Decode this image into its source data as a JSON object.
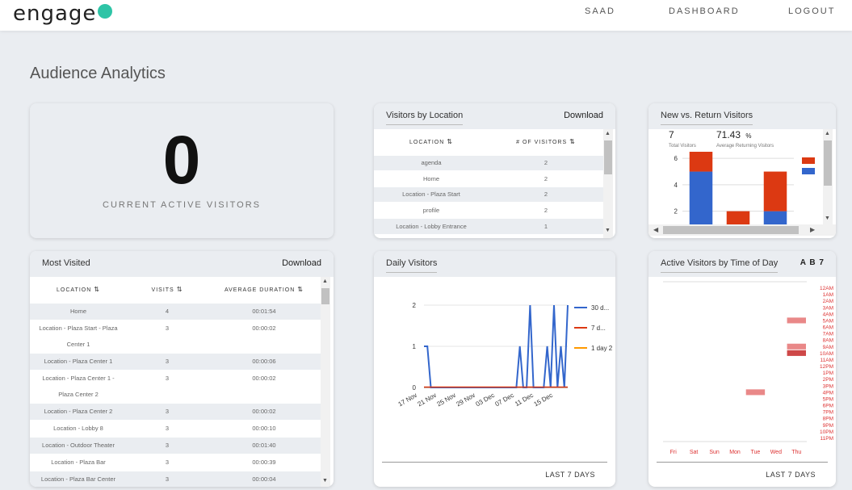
{
  "brand": "engage",
  "nav": {
    "user": "SAAD",
    "dashboard": "DASHBOARD",
    "logout": "LOGOUT"
  },
  "page_title": "Audience Analytics",
  "active": {
    "value": "0",
    "label": "CURRENT ACTIVE VISITORS"
  },
  "by_location": {
    "title": "Visitors by Location",
    "download": "Download",
    "headers": [
      "LOCATION",
      "# OF VISITORS"
    ],
    "rows": [
      [
        "agenda",
        "2"
      ],
      [
        "Home",
        "2"
      ],
      [
        "Location - Plaza Start",
        "2"
      ],
      [
        "profile",
        "2"
      ],
      [
        "Location - Lobby Entrance",
        "1"
      ]
    ]
  },
  "new_return": {
    "title": "New vs. Return Visitors",
    "total_value": "7",
    "total_label": "Total Visitors",
    "avg_value": "71.43",
    "avg_unit": "%",
    "avg_label": "Average Returning Visitors",
    "chart_data": {
      "type": "bar",
      "stacked": true,
      "categories": [
        "",
        "",
        ""
      ],
      "series": [
        {
          "values": [
            4,
            0,
            1
          ],
          "color": "#3366cc"
        },
        {
          "values": [
            2,
            1,
            3
          ],
          "color": "#dc3912"
        }
      ],
      "yticks": [
        2,
        4,
        6
      ],
      "ylim": [
        1,
        6.5
      ]
    }
  },
  "most_visited": {
    "title": "Most Visited",
    "download": "Download",
    "headers": [
      "LOCATION",
      "VISITS",
      "AVERAGE DURATION"
    ],
    "rows": [
      {
        "loc1": "Home",
        "loc2": "",
        "visits": "4",
        "dur": "00:01:54"
      },
      {
        "loc1": "Location - Plaza Start - Plaza",
        "loc2": "Center 1",
        "visits": "3",
        "dur": "00:00:02"
      },
      {
        "loc1": "Location - Plaza Center 1",
        "loc2": "",
        "visits": "3",
        "dur": "00:00:06"
      },
      {
        "loc1": "Location - Plaza Center 1 -",
        "loc2": "Plaza Center 2",
        "visits": "3",
        "dur": "00:00:02"
      },
      {
        "loc1": "Location - Plaza Center 2",
        "loc2": "",
        "visits": "3",
        "dur": "00:00:02"
      },
      {
        "loc1": "Location - Lobby 8",
        "loc2": "",
        "visits": "3",
        "dur": "00:00:10"
      },
      {
        "loc1": "Location - Outdoor Theater",
        "loc2": "",
        "visits": "3",
        "dur": "00:01:40"
      },
      {
        "loc1": "Location - Plaza Bar",
        "loc2": "",
        "visits": "3",
        "dur": "00:00:39"
      },
      {
        "loc1": "Location - Plaza Bar Center",
        "loc2": "",
        "visits": "3",
        "dur": "00:00:04"
      }
    ]
  },
  "daily": {
    "title": "Daily Visitors",
    "footer": "LAST 7 DAYS",
    "chart_data": {
      "type": "line",
      "x": [
        "17 Nov",
        "21 Nov",
        "25 Nov",
        "29 Nov",
        "03 Dec",
        "07 Dec",
        "11 Dec",
        "15 Dec"
      ],
      "ylim": [
        0,
        2
      ],
      "yticks": [
        0,
        1,
        2
      ],
      "series": [
        {
          "name": "30 d...",
          "color": "#3366cc",
          "values": [
            1,
            1,
            0,
            0,
            0,
            0,
            0,
            0,
            0,
            0,
            0,
            0,
            0,
            0,
            0,
            0,
            0,
            0,
            0,
            0,
            0,
            0,
            0,
            0,
            0,
            0,
            0,
            0,
            1,
            0,
            0,
            2,
            0,
            0,
            0,
            0,
            1,
            0,
            2,
            0,
            1,
            0,
            2
          ]
        },
        {
          "name": "7 d...",
          "color": "#dc3912",
          "values": []
        },
        {
          "name": "1 day 2",
          "color": "#ff9900",
          "values": []
        }
      ]
    }
  },
  "time_of_day": {
    "title": "Active Visitors by Time of Day",
    "letters": "A B 7",
    "footer": "LAST 7 DAYS",
    "chart_data": {
      "type": "heatmap",
      "x": [
        "Fri",
        "Sat",
        "Sun",
        "Mon",
        "Tue",
        "Wed",
        "Thu"
      ],
      "y": [
        "12AM",
        "1AM",
        "2AM",
        "3AM",
        "4AM",
        "5AM",
        "6AM",
        "7AM",
        "8AM",
        "9AM",
        "10AM",
        "11AM",
        "12PM",
        "1PM",
        "2PM",
        "3PM",
        "4PM",
        "5PM",
        "6PM",
        "7PM",
        "8PM",
        "9PM",
        "10PM",
        "11PM"
      ],
      "cells": [
        {
          "day": "Tue",
          "hour": "4PM",
          "value": 1
        },
        {
          "day": "Thu",
          "hour": "5AM",
          "value": 1
        },
        {
          "day": "Thu",
          "hour": "9AM",
          "value": 1
        },
        {
          "day": "Thu",
          "hour": "10AM",
          "value": 2
        }
      ]
    }
  }
}
